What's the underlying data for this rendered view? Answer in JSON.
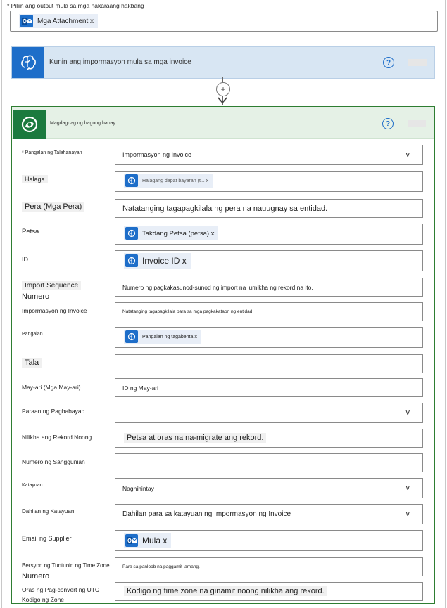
{
  "top": {
    "label": "* Piliin ang output mula sa mga nakaraang hakbang",
    "token": "Mga Attachment x"
  },
  "step1": {
    "title": "Kunin ang impormasyon mula sa mga invoice",
    "help": "?",
    "more": "..."
  },
  "connector": {
    "plus": "+"
  },
  "card": {
    "title": "Magdagdag ng bagong hanay",
    "help": "?",
    "more": "..."
  },
  "rows": [
    {
      "label": "* Pangalan ng Talahanayan",
      "value": "Impormasyon ng Invoice",
      "dropdown": "v"
    },
    {
      "label": "Halaga",
      "token": "Halagang dapat bayaran (t... x"
    },
    {
      "label": "Pera (Mga Pera)",
      "value": "Natatanging tagapagkilala ng pera na nauugnay sa entidad."
    },
    {
      "label": "Petsa",
      "token": "Takdang Petsa (petsa) x"
    },
    {
      "label": "ID",
      "token": "Invoice ID x"
    },
    {
      "label": "Import Sequence",
      "label2": "Numero",
      "value": "Numero ng pagkakasunod-sunod ng import na lumikha ng rekord na ito."
    },
    {
      "label": "Impormasyon ng Invoice",
      "value": "Natatanging tagapagkilala para sa mga pagkakataon ng entidad"
    },
    {
      "label": "Pangalan",
      "token": "Pangalan ng tagabenta x"
    },
    {
      "label": "Tala",
      "value": ""
    },
    {
      "label": "May-ari (Mga May-ari)",
      "value": "ID ng May-ari"
    },
    {
      "label": "Paraan ng Pagbabayad",
      "value": "",
      "dropdown": "v"
    },
    {
      "label": "Nilikha ang Rekord Noong",
      "value": "Petsa at oras na na-migrate ang rekord."
    },
    {
      "label": "Numero ng Sanggunian",
      "value": ""
    },
    {
      "label": "Katayuan",
      "value": "Naghihintay",
      "dropdown": "v"
    },
    {
      "label": "Dahilan ng Katayuan",
      "value": "Dahilan para sa katayuan ng Impormasyon ng Invoice",
      "dropdown": "v"
    },
    {
      "label": "Email ng Supplier",
      "token": "Mula x"
    },
    {
      "label": "Bersyon ng Tuntunin ng Time Zone",
      "label2": "Numero",
      "value": "Para sa panloob na paggamit lamang."
    },
    {
      "label": "Oras ng Pag-convert ng UTC",
      "label2": "Kodigo ng Zone",
      "value": "Kodigo ng time zone na ginamit noong nilikha ang rekord."
    }
  ],
  "colors": {
    "step_blue": "#1e6ec9",
    "card_green": "#1b7a3e",
    "card_border": "#2e7d32"
  },
  "icons": {
    "outlook": "outlook-icon",
    "brain": "ai-builder-brain-icon",
    "dataverse": "dataverse-icon"
  }
}
